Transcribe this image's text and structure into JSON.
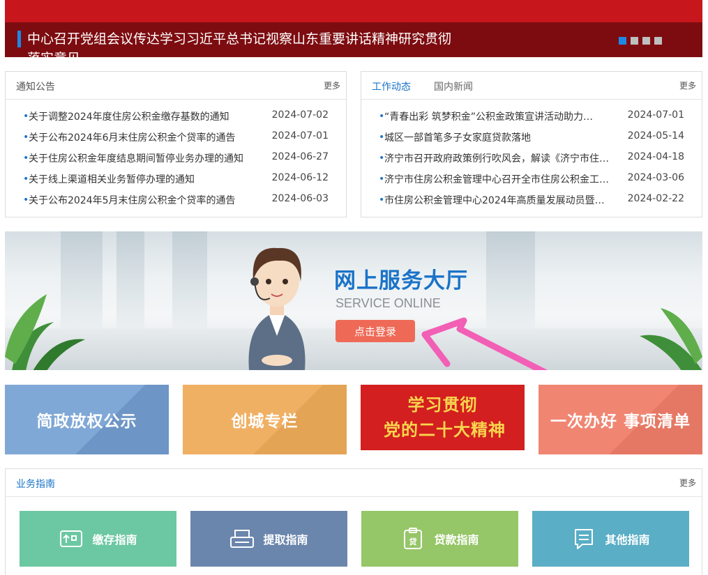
{
  "headline": {
    "title": "中心召开党组会议传达学习习近平总书记视察山东重要讲话精神研究贯彻落实意见",
    "slide_count": 4,
    "active_slide": 1,
    "accent_color": "#c8161d"
  },
  "notice_panel": {
    "tab_label": "通知公告",
    "more_label": "更多",
    "items": [
      {
        "title": "关于调整2024年度住房公积金缴存基数的通知",
        "date": "2024-07-02"
      },
      {
        "title": "关于公布2024年6月末住房公积金个贷率的通告",
        "date": "2024-07-01"
      },
      {
        "title": "关于住房公积金年度结息期间暂停业务办理的通知",
        "date": "2024-06-27"
      },
      {
        "title": "关于线上渠道相关业务暂停办理的通知",
        "date": "2024-06-12"
      },
      {
        "title": "关于公布2024年5月末住房公积金个贷率的通告",
        "date": "2024-06-03"
      }
    ]
  },
  "work_panel": {
    "tabs": [
      "工作动态",
      "国内新闻"
    ],
    "more_label": "更多",
    "items": [
      {
        "title": "“青春出彩 筑梦积金”公积金政策宣讲活动助力…",
        "date": "2024-07-01"
      },
      {
        "title": "城区一部首笔多子女家庭贷款落地",
        "date": "2024-05-14"
      },
      {
        "title": "济宁市召开政府政策例行吹风会，解读《济宁市住…",
        "date": "2024-04-18"
      },
      {
        "title": "济宁市住房公积金管理中心召开全市住房公积金工…",
        "date": "2024-03-06"
      },
      {
        "title": "市住房公积金管理中心2024年高质量发展动员暨…",
        "date": "2024-02-22"
      }
    ]
  },
  "service_banner": {
    "title": "网上服务大厅",
    "subtitle": "SERVICE ONLINE",
    "login_label": "点击登录"
  },
  "feature_tiles": [
    {
      "label": "简政放权公示"
    },
    {
      "label": "创城专栏"
    },
    {
      "line1": "学习贯彻",
      "line2": "党的二十大精神"
    },
    {
      "label": "一次办好 事项清单"
    }
  ],
  "guide_panel": {
    "tab_label": "业务指南",
    "more_label": "更多",
    "cards": [
      {
        "label": "缴存指南",
        "icon": "deposit-icon"
      },
      {
        "label": "提取指南",
        "icon": "printer-withdraw-icon"
      },
      {
        "label": "贷款指南",
        "icon": "loan-clipboard-icon"
      },
      {
        "label": "其他指南",
        "icon": "document-chat-icon"
      }
    ]
  }
}
